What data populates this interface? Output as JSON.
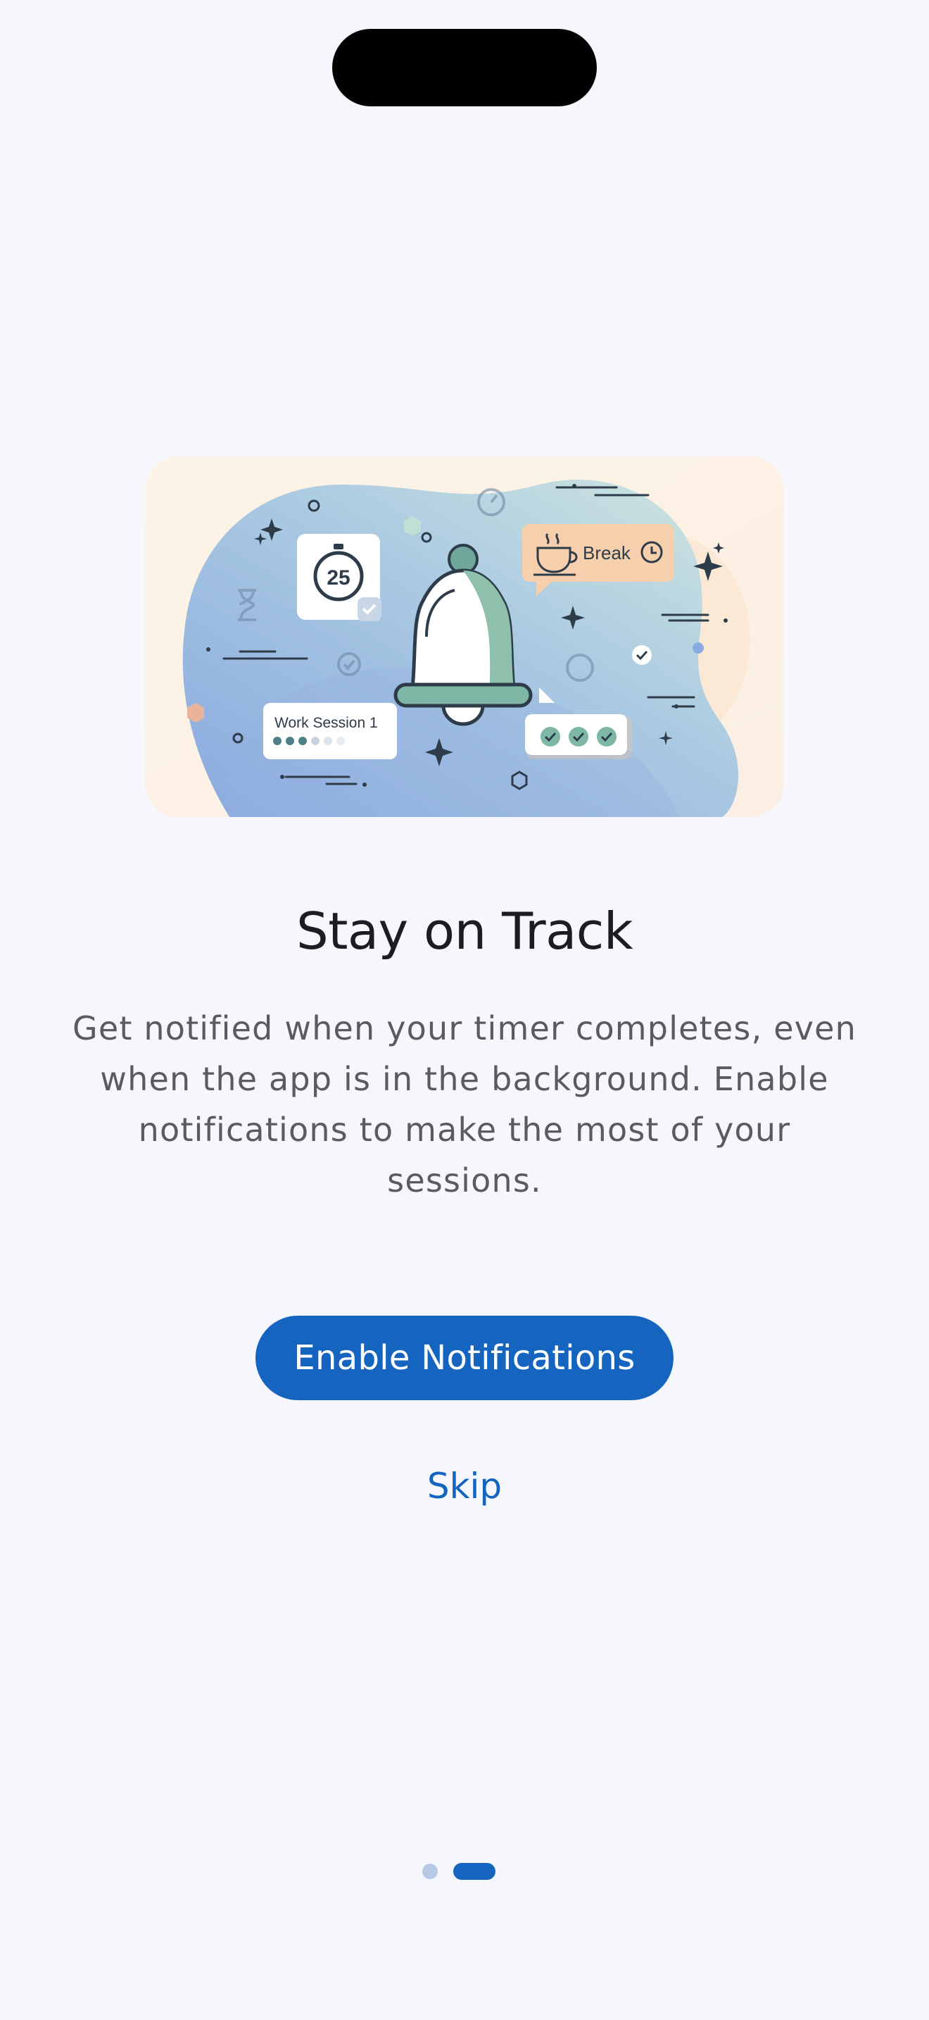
{
  "onboarding": {
    "title": "Stay on Track",
    "description": "Get notified when your timer completes, even when the app is in the background. Enable notifications to make the most of your sessions.",
    "primary_button_label": "Enable Notifications",
    "secondary_button_label": "Skip"
  },
  "illustration": {
    "timer_value": "25",
    "break_label": "Break",
    "session_label": "Work Session 1",
    "icons": [
      "bell-icon",
      "stopwatch-icon",
      "coffee-cup-icon",
      "clock-icon",
      "hourglass-icon",
      "checkmark-icon",
      "sparkle-icon"
    ]
  },
  "pagination": {
    "total": 2,
    "current": 2
  },
  "colors": {
    "accent": "#1565c0",
    "background": "#f5f7fc",
    "title": "#1c1c22",
    "body_text": "#5a5a60",
    "inactive_dot": "#b5c9e4"
  }
}
